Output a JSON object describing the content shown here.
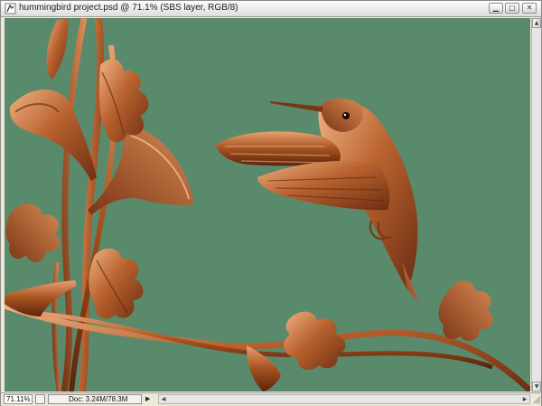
{
  "window": {
    "title": "hummingbird project.psd @ 71.1% (SBS layer, RGB/8)",
    "app_icon": "photoshop-document-icon"
  },
  "window_controls": {
    "minimize_icon": "minimize-icon",
    "maximize_icon": "maximize-icon",
    "close_icon": "close-icon"
  },
  "canvas": {
    "background_color": "#5a8a6c",
    "artwork_color": "#b0602f",
    "subject": "copper hummingbird with flowers and oak leaves"
  },
  "status_bar": {
    "zoom_value": "71.11%",
    "doc_info": "Doc: 3.24M/78.3M",
    "menu_arrow_icon": "triangle-right-icon"
  },
  "scrollbars": {
    "vertical_icons": [
      "scroll-up-icon",
      "scroll-down-icon"
    ],
    "horizontal_icons": [
      "scroll-left-icon",
      "scroll-right-icon"
    ]
  }
}
